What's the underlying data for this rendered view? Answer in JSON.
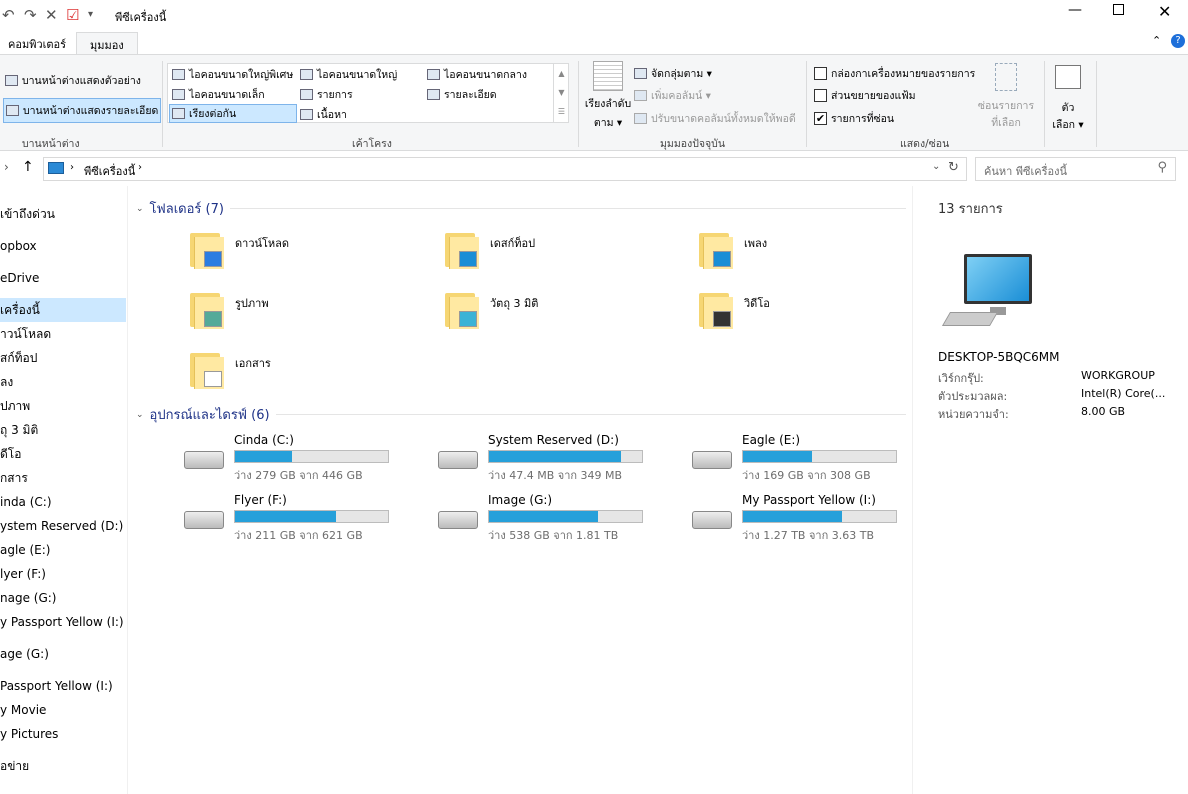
{
  "title": "พีซีเครื่องนี้",
  "tabs": [
    "คอมพิวเตอร์",
    "มุมมอง"
  ],
  "ribbon": {
    "panes": {
      "preview": "บานหน้าต่างแสดงตัวอย่าง",
      "details": "บานหน้าต่างแสดงรายละเอียด",
      "group": "บานหน้าต่าง"
    },
    "layout": {
      "items": [
        "ไอคอนขนาดใหญ่พิเศษ",
        "ไอคอนขนาดใหญ่",
        "ไอคอนขนาดกลาง",
        "ไอคอนขนาดเล็ก",
        "รายการ",
        "รายละเอียด",
        "เรียงต่อกัน",
        "เนื้อหา"
      ],
      "group": "เค้าโครง"
    },
    "current": {
      "sort1": "เรียงลำดับ",
      "sort2": "ตาม ▾",
      "group_by": "จัดกลุ่มตาม ▾",
      "add_col": "เพิ่มคอลัมน์ ▾",
      "fit_cols": "ปรับขนาดคอลัมน์ทั้งหมดให้พอดี",
      "group": "มุมมองปัจจุบัน"
    },
    "show": {
      "checkboxes": "กล่องกาเครื่องหมายของรายการ",
      "extensions": "ส่วนขยายของแฟ้ม",
      "hidden": "รายการที่ซ่อน",
      "hide_sel1": "ซ่อนรายการ",
      "hide_sel2": "ที่เลือก",
      "group": "แสดง/ซ่อน"
    },
    "options1": "ตัว",
    "options2": "เลือก ▾"
  },
  "address": {
    "crumb": "พีซีเครื่องนี้",
    "search_placeholder": "ค้นหา พีซีเครื่องนี้"
  },
  "sidebar": [
    "เข้าถึงด่วน",
    "opbox",
    "eDrive",
    "เครื่องนี้",
    "าวน์โหลด",
    "สก์ท็อป",
    "ลง",
    "ปภาพ",
    "ถุ 3 มิติ",
    "ดีโอ",
    "กสาร",
    "inda (C:)",
    "ystem Reserved (D:)",
    "agle (E:)",
    "lyer (F:)",
    "nage (G:)",
    "y Passport Yellow (I:)",
    "age (G:)",
    "Passport Yellow (I:)",
    "y Movie",
    "y Pictures",
    "อข่าย"
  ],
  "folders": {
    "header": "โฟลเดอร์ (7)",
    "items": [
      "ดาวน์โหลด",
      "เดสก์ท็อป",
      "เพลง",
      "รูปภาพ",
      "วัตถุ 3 มิติ",
      "วิดีโอ",
      "เอกสาร"
    ]
  },
  "drives": {
    "header": "อุปกรณ์และไดรฟ์ (6)",
    "items": [
      {
        "name": "Cinda (C:)",
        "free": "ว่าง 279 GB จาก 446 GB",
        "used": 0.37
      },
      {
        "name": "System Reserved (D:)",
        "free": "ว่าง 47.4 MB จาก 349 MB",
        "used": 0.86
      },
      {
        "name": "Eagle (E:)",
        "free": "ว่าง 169 GB จาก 308 GB",
        "used": 0.45
      },
      {
        "name": "Flyer (F:)",
        "free": "ว่าง 211 GB จาก 621 GB",
        "used": 0.66
      },
      {
        "name": "Image (G:)",
        "free": "ว่าง 538 GB จาก 1.81 TB",
        "used": 0.71
      },
      {
        "name": "My Passport Yellow (I:)",
        "free": "ว่าง 1.27 TB จาก 3.63 TB",
        "used": 0.65
      }
    ]
  },
  "details": {
    "count": "13 รายการ",
    "name": "DESKTOP-5BQC6MM",
    "rows": [
      [
        "เวิร์กกรุ๊ป:",
        "WORKGROUP"
      ],
      [
        "ตัวประมวลผล:",
        "Intel(R) Core(..."
      ],
      [
        "หน่วยความจำ:",
        "8.00 GB"
      ]
    ]
  }
}
